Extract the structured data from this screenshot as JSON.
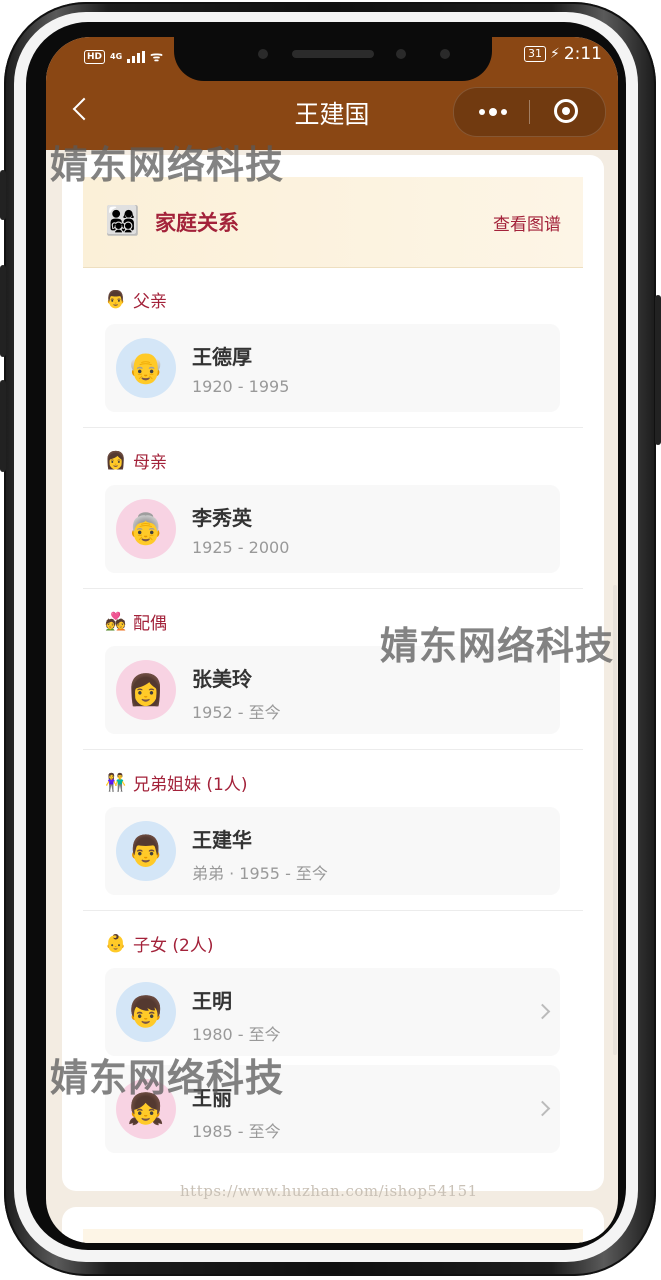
{
  "status_bar": {
    "hd": "HD",
    "network": "4G",
    "battery": "31",
    "time": "2:11"
  },
  "nav": {
    "title": "王建国"
  },
  "card": {
    "title": "家庭关系",
    "view_map": "查看图谱",
    "family_icon": "👨‍👩‍👧‍👦"
  },
  "sections": {
    "father": {
      "label": "父亲",
      "emoji": "👨",
      "person": {
        "name": "王德厚",
        "years": "1920 - 1995",
        "avatar": "👴"
      }
    },
    "mother": {
      "label": "母亲",
      "emoji": "👩",
      "person": {
        "name": "李秀英",
        "years": "1925 - 2000",
        "avatar": "👵"
      }
    },
    "spouse": {
      "label": "配偶",
      "emoji": "💑",
      "person": {
        "name": "张美玲",
        "years": "1952 - 至今",
        "avatar": "👩"
      }
    },
    "siblings": {
      "label": "兄弟姐妹 (1人)",
      "emoji": "👫",
      "person": {
        "name": "王建华",
        "years": "弟弟 · 1955 - 至今",
        "avatar": "👨"
      }
    },
    "children": {
      "label": "子女 (2人)",
      "emoji": "👶",
      "people": [
        {
          "name": "王明",
          "years": "1980 - 至今",
          "avatar": "👦"
        },
        {
          "name": "王丽",
          "years": "1985 - 至今",
          "avatar": "👧"
        }
      ]
    }
  },
  "watermarks": {
    "text": "婧东网络科技",
    "url": "https://www.huzhan.com/ishop54151"
  },
  "colors": {
    "nav_bg": "#8a4714",
    "accent": "#a3223a"
  }
}
